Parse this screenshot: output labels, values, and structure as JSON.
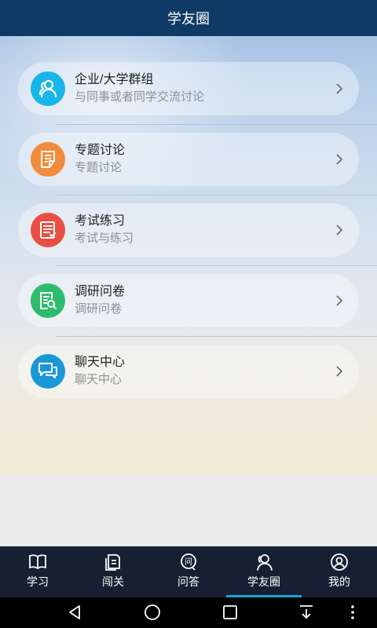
{
  "header": {
    "title": "学友圈"
  },
  "items": [
    {
      "title": "企业/大学群组",
      "subtitle": "与同事或者同学交流讨论",
      "icon": "group-icon",
      "color": "#16b6e8"
    },
    {
      "title": "专题讨论",
      "subtitle": "专题讨论",
      "icon": "document-edit-icon",
      "color": "#f28b3a"
    },
    {
      "title": "考试练习",
      "subtitle": "考试与练习",
      "icon": "exam-list-icon",
      "color": "#e94e43"
    },
    {
      "title": "调研问卷",
      "subtitle": "调研问卷",
      "icon": "survey-search-icon",
      "color": "#2ebd6e"
    },
    {
      "title": "聊天中心",
      "subtitle": "聊天中心",
      "icon": "chat-bubbles-icon",
      "color": "#1a98d6"
    }
  ],
  "tabs": [
    {
      "label": "学习",
      "icon": "book-icon"
    },
    {
      "label": "闯关",
      "icon": "pages-icon"
    },
    {
      "label": "问答",
      "icon": "question-bubble-icon"
    },
    {
      "label": "学友圈",
      "icon": "friends-icon",
      "active": true
    },
    {
      "label": "我的",
      "icon": "user-icon"
    }
  ],
  "system_nav": [
    "back-icon",
    "home-icon",
    "recents-icon",
    "download-icon",
    "more-icon"
  ]
}
